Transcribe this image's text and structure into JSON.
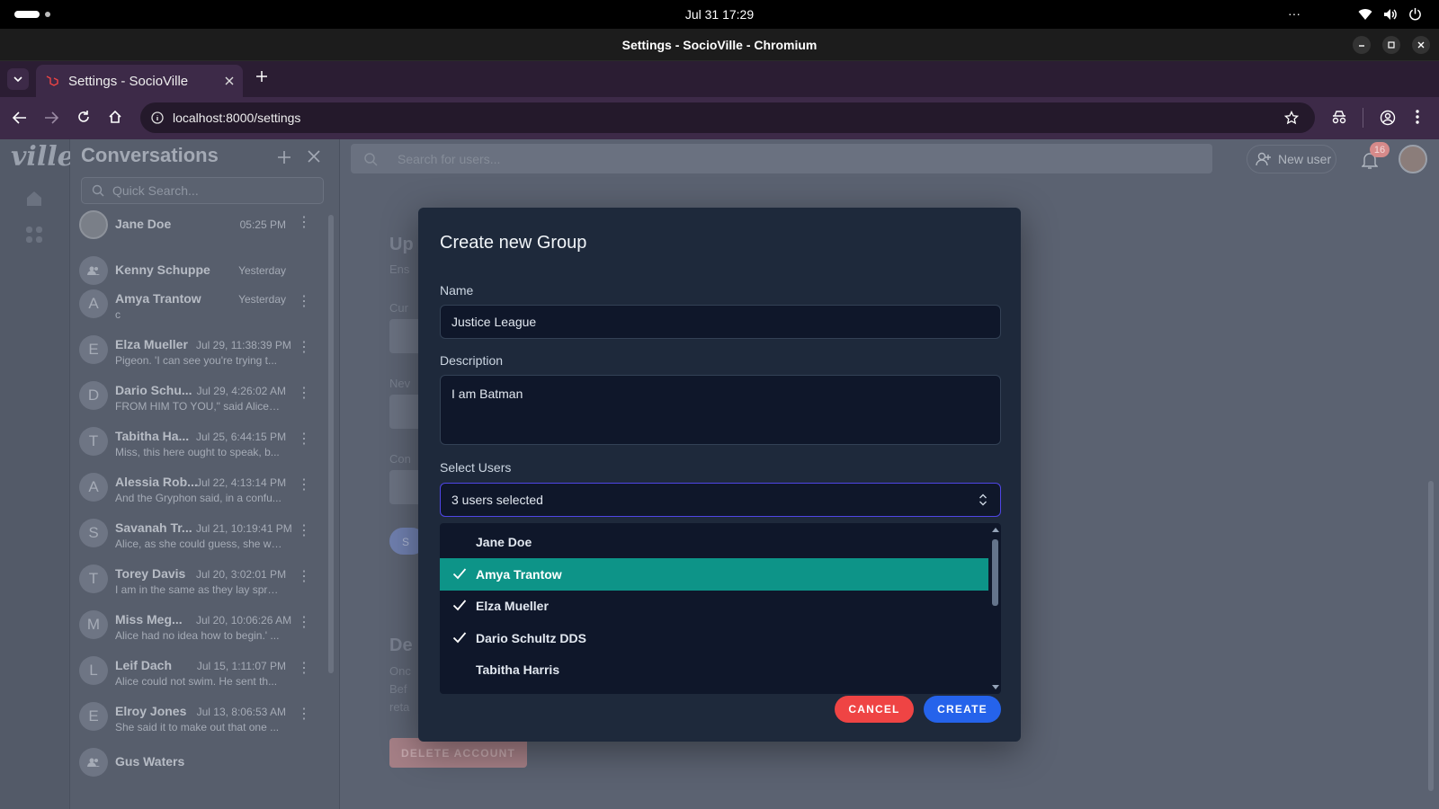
{
  "os": {
    "clock": "Jul 31  17:29",
    "overflow": "···"
  },
  "window": {
    "title": "Settings - SocioVille - Chromium"
  },
  "browser": {
    "tab_title": "Settings - SocioVille",
    "url": "localhost:8000/settings"
  },
  "app": {
    "logo": "ville",
    "conversations_title": "Conversations",
    "quick_search_placeholder": "Quick Search...",
    "search_users_placeholder": "Search for users...",
    "new_user_label": "New user",
    "notification_count": "16",
    "conversations": [
      {
        "initial": "",
        "name": "Jane Doe",
        "time": "05:25 PM",
        "preview": "",
        "avatar": "photo"
      },
      {
        "initial": "",
        "name": "Kenny Schuppe",
        "time": "Yesterday",
        "preview": "",
        "avatar": "group"
      },
      {
        "initial": "A",
        "name": "Amya Trantow",
        "time": "Yesterday",
        "preview": "c",
        "avatar": "letter"
      },
      {
        "initial": "E",
        "name": "Elza Mueller",
        "time": "Jul 29, 11:38:39 PM",
        "preview": "Pigeon. 'I can see you're trying t...",
        "avatar": "letter"
      },
      {
        "initial": "D",
        "name": "Dario Schu...",
        "time": "Jul 29, 4:26:02 AM",
        "preview": "FROM HIM TO YOU,\" said Alice. ...",
        "avatar": "letter"
      },
      {
        "initial": "T",
        "name": "Tabitha Ha...",
        "time": "Jul 25, 6:44:15 PM",
        "preview": "Miss, this here ought to speak, b...",
        "avatar": "letter"
      },
      {
        "initial": "A",
        "name": "Alessia Rob...",
        "time": "Jul 22, 4:13:14 PM",
        "preview": "And the Gryphon said, in a confu...",
        "avatar": "letter"
      },
      {
        "initial": "S",
        "name": "Savanah Tr...",
        "time": "Jul 21, 10:19:41 PM",
        "preview": "Alice, as she could guess, she wa...",
        "avatar": "letter"
      },
      {
        "initial": "T",
        "name": "Torey Davis",
        "time": "Jul 20, 3:02:01 PM",
        "preview": "I am in the same as they lay spra...",
        "avatar": "letter"
      },
      {
        "initial": "M",
        "name": "Miss Meg...",
        "time": "Jul 20, 10:06:26 AM",
        "preview": "Alice had no idea how to begin.' ...",
        "avatar": "letter"
      },
      {
        "initial": "L",
        "name": "Leif Dach",
        "time": "Jul 15, 1:11:07 PM",
        "preview": "Alice could not swim. He sent th...",
        "avatar": "letter"
      },
      {
        "initial": "E",
        "name": "Elroy Jones",
        "time": "Jul 13, 8:06:53 AM",
        "preview": "She said it to make out that one ...",
        "avatar": "letter"
      },
      {
        "initial": "",
        "name": "Gus Waters",
        "time": "",
        "preview": "",
        "avatar": "group"
      }
    ],
    "background_page": {
      "section1_title": "Up",
      "section1_sub": "Ens",
      "field_cur": "Cur",
      "field_new": "Nev",
      "field_con": "Con",
      "save_btn_stub": "S",
      "section2_title": "De",
      "section2_lines": [
        "Onc",
        "Bef",
        "reta"
      ],
      "delete_account": "DELETE ACCOUNT"
    }
  },
  "modal": {
    "title": "Create new Group",
    "name_label": "Name",
    "name_value": "Justice League",
    "description_label": "Description",
    "description_value": "I am Batman",
    "select_label": "Select Users",
    "select_value": "3 users selected",
    "options": [
      {
        "label": "Jane Doe",
        "selected": false,
        "highlighted": false
      },
      {
        "label": "Amya Trantow",
        "selected": true,
        "highlighted": true
      },
      {
        "label": "Elza Mueller",
        "selected": true,
        "highlighted": false
      },
      {
        "label": "Dario Schultz DDS",
        "selected": true,
        "highlighted": false
      },
      {
        "label": "Tabitha Harris",
        "selected": false,
        "highlighted": false
      }
    ],
    "cancel_label": "CANCEL",
    "create_label": "CREATE"
  },
  "colors": {
    "highlight": "#0d9488",
    "cancel": "#ef4444",
    "create": "#2563eb",
    "select_border": "#4f46e5",
    "notification_badge": "#e87b7b"
  }
}
